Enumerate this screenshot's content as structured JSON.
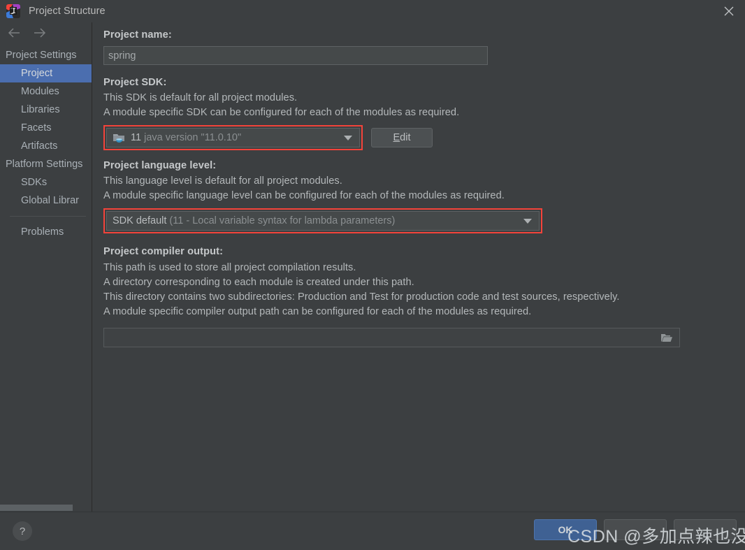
{
  "window": {
    "title": "Project Structure",
    "app_icon": "intellij-idea-logo",
    "close_icon": "close-icon"
  },
  "sidebar": {
    "nav": {
      "back_icon": "arrow-left-icon",
      "forward_icon": "arrow-right-icon"
    },
    "groups": [
      {
        "label": "Project Settings",
        "items": [
          {
            "label": "Project",
            "selected": true
          },
          {
            "label": "Modules",
            "selected": false
          },
          {
            "label": "Libraries",
            "selected": false
          },
          {
            "label": "Facets",
            "selected": false
          },
          {
            "label": "Artifacts",
            "selected": false
          }
        ]
      },
      {
        "label": "Platform Settings",
        "items": [
          {
            "label": "SDKs",
            "selected": false
          },
          {
            "label": "Global Librar",
            "selected": false
          }
        ]
      }
    ],
    "extra_items": [
      {
        "label": "Problems",
        "selected": false
      }
    ]
  },
  "main": {
    "project_name": {
      "label": "Project name:",
      "value": "spring"
    },
    "project_sdk": {
      "label": "Project SDK:",
      "desc_line1": "This SDK is default for all project modules.",
      "desc_line2": "A module specific SDK can be configured for each of the modules as required.",
      "selected_version": "11",
      "selected_detail": "java version \"11.0.10\"",
      "sdk_icon": "java-sdk-folder-icon",
      "caret_icon": "chevron-down-icon",
      "edit_button": "Edit",
      "edit_button_mnemonic": "E",
      "edit_button_rest": "dit",
      "highlighted": true
    },
    "language_level": {
      "label": "Project language level:",
      "desc_line1": "This language level is default for all project modules.",
      "desc_line2": "A module specific language level can be configured for each of the modules as required.",
      "selected_main": "SDK default",
      "selected_detail": "(11 - Local variable syntax for lambda parameters)",
      "caret_icon": "chevron-down-icon",
      "highlighted": true
    },
    "compiler_output": {
      "label": "Project compiler output:",
      "desc_line1": "This path is used to store all project compilation results.",
      "desc_line2": "A directory corresponding to each module is created under this path.",
      "desc_line3": "This directory contains two subdirectories: Production and Test for production code and test sources, respectively.",
      "desc_line4": "A module specific compiler output path can be configured for each of the modules as required.",
      "value": "",
      "placeholder": "",
      "browse_icon": "folder-open-icon"
    }
  },
  "footer": {
    "help_label": "?",
    "help_icon": "question-mark-icon",
    "buttons": [
      {
        "label": "OK",
        "primary": true
      },
      {
        "label": "",
        "primary": false
      },
      {
        "label": "",
        "primary": false
      }
    ]
  },
  "watermark": {
    "text": "CSDN @多加点辣也没关系"
  },
  "colors": {
    "background": "#3c3f41",
    "selection": "#4b6eaf",
    "annotation_red": "#f4433a",
    "primary_button": "#3f6193"
  }
}
